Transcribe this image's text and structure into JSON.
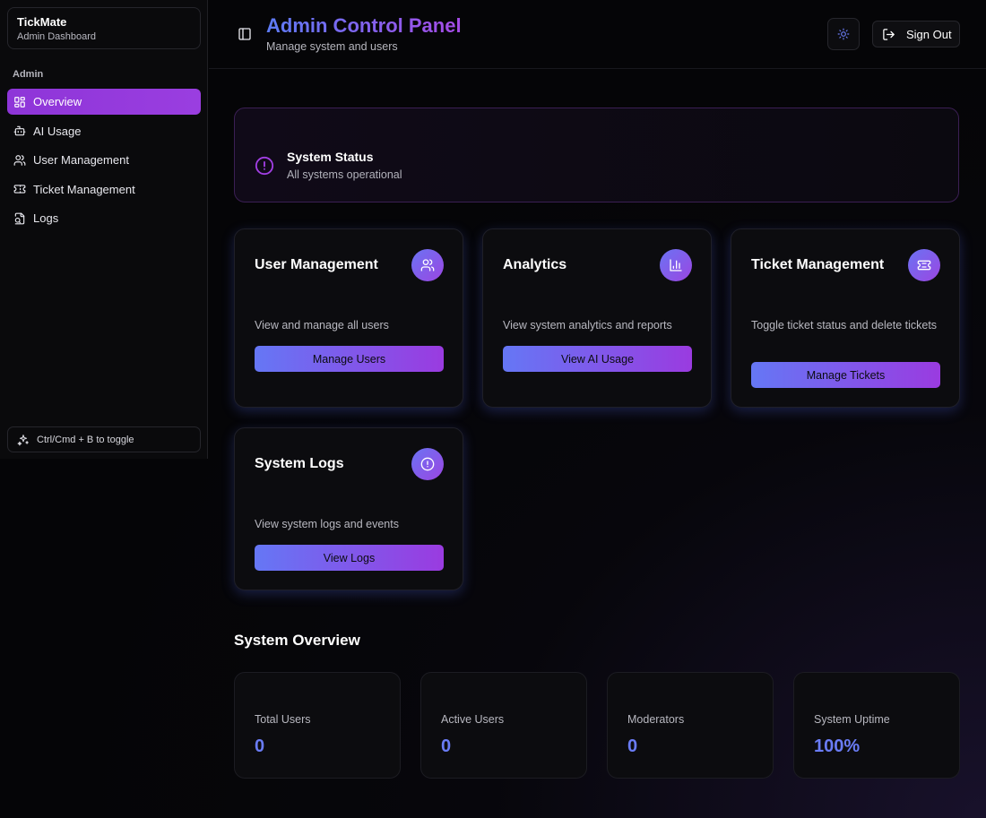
{
  "app": {
    "name": "TickMate",
    "subtitle": "Admin Dashboard"
  },
  "sidebar": {
    "group_label": "Admin",
    "items": [
      {
        "label": "Overview",
        "icon": "layout-grid-icon",
        "active": true
      },
      {
        "label": "AI Usage",
        "icon": "bot-icon",
        "active": false
      },
      {
        "label": "User Management",
        "icon": "users-icon",
        "active": false
      },
      {
        "label": "Ticket Management",
        "icon": "ticket-icon",
        "active": false
      },
      {
        "label": "Logs",
        "icon": "file-search-icon",
        "active": false
      }
    ],
    "toggle_hint": "Ctrl/Cmd + B to toggle"
  },
  "header": {
    "title": "Admin Control Panel",
    "subtitle": "Manage system and users",
    "signout_label": "Sign Out"
  },
  "status": {
    "title": "System Status",
    "message": "All systems operational"
  },
  "cards": [
    {
      "title": "User Management",
      "description": "View and manage all users",
      "button": "Manage Users",
      "icon": "users-icon"
    },
    {
      "title": "Analytics",
      "description": "View system analytics and reports",
      "button": "View AI Usage",
      "icon": "bar-chart-icon"
    },
    {
      "title": "Ticket Management",
      "description": "Toggle ticket status and delete tickets",
      "button": "Manage Tickets",
      "icon": "ticket-icon"
    },
    {
      "title": "System Logs",
      "description": "View system logs and events",
      "button": "View Logs",
      "icon": "alert-circle-icon"
    }
  ],
  "overview": {
    "title": "System Overview",
    "stats": [
      {
        "label": "Total Users",
        "value": "0"
      },
      {
        "label": "Active Users",
        "value": "0"
      },
      {
        "label": "Moderators",
        "value": "0"
      },
      {
        "label": "System Uptime",
        "value": "100%"
      }
    ]
  },
  "colors": {
    "accent_start": "#5d7cf7",
    "accent_end": "#a64be6",
    "active_nav": "#8e35d8",
    "stat_value": "#6a7cf5"
  }
}
